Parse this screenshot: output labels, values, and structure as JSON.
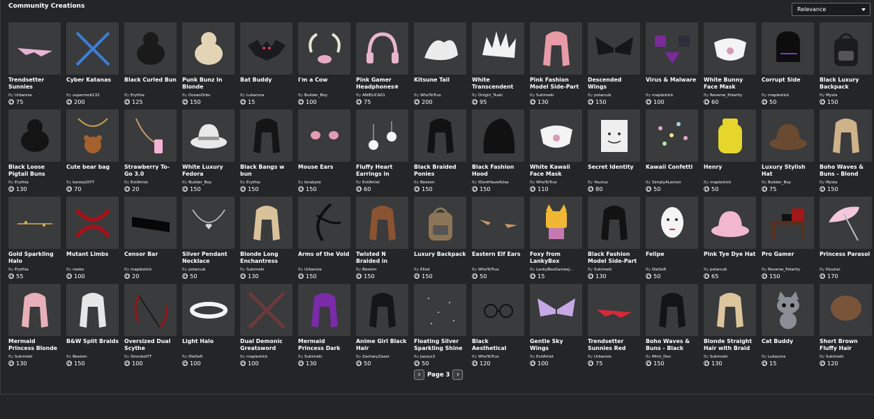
{
  "header": {
    "title": "Community Creations"
  },
  "sort": {
    "selected": "Relevance"
  },
  "by_prefix": "By",
  "items": [
    {
      "name": "Trendsetter Sunnies",
      "creator": "Urbanize",
      "price": "75",
      "icon": "sunglasses-icon",
      "color": "#e8b3d6"
    },
    {
      "name": "Cyber Katanas",
      "creator": "supermob132",
      "price": "200",
      "icon": "katana-icon",
      "color": "#3c7fd9"
    },
    {
      "name": "Black Curled Bun",
      "creator": "Erythia",
      "price": "125",
      "icon": "hair-bun-icon",
      "color": "#1a1a1a"
    },
    {
      "name": "Punk Bunz In Blonde",
      "creator": "OceanOrbs",
      "price": "150",
      "icon": "hair-bun-icon",
      "color": "#e4d4b6"
    },
    {
      "name": "Bat Buddy",
      "creator": "Lukacora",
      "price": "15",
      "icon": "bat-icon",
      "color": "#1b1b1f"
    },
    {
      "name": "I'm a Cow",
      "creator": "Builder_Boy",
      "price": "100",
      "icon": "horns-icon",
      "color": "#e9e3d2"
    },
    {
      "name": "Pink Gamer Headphones❀",
      "creator": "ANIELICA01",
      "price": "75",
      "icon": "headphones-icon",
      "color": "#e8b6cc"
    },
    {
      "name": "Kitsune Tail",
      "creator": "WhoToTrus",
      "price": "200",
      "icon": "tail-icon",
      "color": "#ececec"
    },
    {
      "name": "White Transcendent",
      "creator": "Onigiri_Tsuki",
      "price": "95",
      "icon": "spiky-hair-icon",
      "color": "#f2f2f2"
    },
    {
      "name": "Pink Fashion Model Side-Part",
      "creator": "Sukimeki",
      "price": "130",
      "icon": "long-hair-icon",
      "color": "#e89aa6"
    },
    {
      "name": "Descended Wings",
      "creator": "polarcub",
      "price": "150",
      "icon": "wings-icon",
      "color": "#161616"
    },
    {
      "name": "Virus & Malware",
      "creator": "maplestick",
      "price": "100",
      "icon": "virus-icon",
      "color": "#7a2a9a"
    },
    {
      "name": "White Bunny Face Mask",
      "creator": "Reverse_Polarity",
      "price": "60",
      "icon": "face-mask-icon",
      "color": "#f4f4f4"
    },
    {
      "name": "Corrupt Side",
      "creator": "maplestick",
      "price": "50",
      "icon": "helmet-icon",
      "color": "#0d0d0d"
    },
    {
      "name": "Black Luxury Backpack",
      "creator": "Mysta",
      "price": "150",
      "icon": "backpack-icon",
      "color": "#1c1c1e"
    },
    {
      "name": "Black Loose Pigtail Buns",
      "creator": "Erythia",
      "price": "130",
      "icon": "hair-bun-icon",
      "color": "#141414"
    },
    {
      "name": "Cute bear bag",
      "creator": "karola20YT",
      "price": "70",
      "icon": "bear-bag-icon",
      "color": "#a5612d"
    },
    {
      "name": "Strawberry To-Go 3.0",
      "creator": "EvilArtist",
      "price": "20",
      "icon": "drink-icon",
      "color": "#f2b3d4"
    },
    {
      "name": "White Luxury Fedora",
      "creator": "Builder_Boy",
      "price": "150",
      "icon": "hat-icon",
      "color": "#e8e8e8"
    },
    {
      "name": "Black Bangs w bun",
      "creator": "Erythia",
      "price": "150",
      "icon": "long-hair-icon",
      "color": "#151515"
    },
    {
      "name": "Mouse Ears",
      "creator": "terabyte",
      "price": "150",
      "icon": "ears-icon",
      "color": "#e49ab2"
    },
    {
      "name": "Fluffy Heart Earrings in White",
      "creator": "EvilArtist",
      "price": "60",
      "icon": "earrings-icon",
      "color": "#f5f5f5"
    },
    {
      "name": "Black Braided Ponies",
      "creator": "Beeism",
      "price": "150",
      "icon": "long-hair-icon",
      "color": "#121212"
    },
    {
      "name": "Black Fashion Hood",
      "creator": "IDontHaveAUse",
      "price": "150",
      "icon": "hood-icon",
      "color": "#111111"
    },
    {
      "name": "White Kawaii Face Mask",
      "creator": "WhoToTrus",
      "price": "110",
      "icon": "face-mask-icon",
      "color": "#f3f3f3"
    },
    {
      "name": "Secret Identity",
      "creator": "Yourius",
      "price": "80",
      "icon": "paper-bag-icon",
      "color": "#efefef"
    },
    {
      "name": "Kawaii Confetti",
      "creator": "SimplyALemon",
      "price": "50",
      "icon": "confetti-icon",
      "color": "#e3a6c8"
    },
    {
      "name": "Henry",
      "creator": "maplestick",
      "price": "50",
      "icon": "noob-head-icon",
      "color": "#e6d52a"
    },
    {
      "name": "Luxury Stylish Hat",
      "creator": "Builder_Boy",
      "price": "75",
      "icon": "bucket-hat-icon",
      "color": "#6a4a30"
    },
    {
      "name": "Boho Waves & Buns - Blond",
      "creator": "Mysta",
      "price": "150",
      "icon": "long-hair-icon",
      "color": "#cdb28a"
    },
    {
      "name": "Gold Sparkling Halo",
      "creator": "Erythia",
      "price": "55",
      "icon": "halo-icon",
      "color": "#d8b24a"
    },
    {
      "name": "Mutant Limbs",
      "creator": "nesko",
      "price": "100",
      "icon": "limbs-icon",
      "color": "#a0141a"
    },
    {
      "name": "Censor Bar",
      "creator": "maplestick",
      "price": "20",
      "icon": "censor-bar-icon",
      "color": "#060606"
    },
    {
      "name": "Silver Pendant Necklace",
      "creator": "polarcub",
      "price": "50",
      "icon": "necklace-icon",
      "color": "#d8d8d8"
    },
    {
      "name": "Blonde Long Enchantress Hair",
      "creator": "Sukimeki",
      "price": "130",
      "icon": "long-hair-icon",
      "color": "#d9c29a"
    },
    {
      "name": "Arms of the Void",
      "creator": "Urbanize",
      "price": "150",
      "icon": "tentacle-icon",
      "color": "#0e0e0e"
    },
    {
      "name": "Twisted N Braided in",
      "creator": "Beeism",
      "price": "150",
      "icon": "long-hair-icon",
      "color": "#8a5432"
    },
    {
      "name": "Luxury Backpack",
      "creator": "Ellod",
      "price": "150",
      "icon": "backpack-icon",
      "color": "#8c7556"
    },
    {
      "name": "Eastern Elf Ears",
      "creator": "WhoToTrus",
      "price": "50",
      "icon": "elf-ears-icon",
      "color": "#c9956a"
    },
    {
      "name": "Foxy from LankyBox",
      "creator": "LankyBoxGamesJ...",
      "price": "15",
      "icon": "fox-icon",
      "color": "#f0b832"
    },
    {
      "name": "Black Fashion Model Side-Part",
      "creator": "Sukimeki",
      "price": "130",
      "icon": "long-hair-icon",
      "color": "#121212"
    },
    {
      "name": "Felipe",
      "creator": "DieSoft",
      "price": "50",
      "icon": "mask-head-icon",
      "color": "#f4f4f4"
    },
    {
      "name": "Pink Tye Dye Hat",
      "creator": "polarcub",
      "price": "65",
      "icon": "bucket-hat-icon",
      "color": "#f2b7cf"
    },
    {
      "name": "Pro Gamer",
      "creator": "Reverse_Polarity",
      "price": "150",
      "icon": "desk-icon",
      "color": "#5a2e1e"
    },
    {
      "name": "Princess Parasol",
      "creator": "Kiouhei",
      "price": "170",
      "icon": "parasol-icon",
      "color": "#f3c8dc"
    },
    {
      "name": "Mermaid Princess Blonde to Pink",
      "creator": "Sukimeki",
      "price": "130",
      "icon": "long-hair-icon",
      "color": "#e7b0b8"
    },
    {
      "name": "B&W Split Braids",
      "creator": "Beeism",
      "price": "150",
      "icon": "long-hair-icon",
      "color": "#e6e6e6"
    },
    {
      "name": "Oversized Dual Scythe",
      "creator": "StronbolYT",
      "price": "100",
      "icon": "scythe-icon",
      "color": "#8e1717"
    },
    {
      "name": "Light Halo",
      "creator": "DieSoft",
      "price": "100",
      "icon": "ring-halo-icon",
      "color": "#f4f4f4"
    },
    {
      "name": "Dual Demonic Greatsword",
      "creator": "maplestick",
      "price": "100",
      "icon": "swords-icon",
      "color": "#6b3a3a"
    },
    {
      "name": "Mermaid Princess Dark Purple Hair",
      "creator": "Sukimeki",
      "price": "130",
      "icon": "long-hair-icon",
      "color": "#7a2ba8"
    },
    {
      "name": "Anime Girl Black Hair",
      "creator": "ZacharyZaxor",
      "price": "50",
      "icon": "long-hair-icon",
      "color": "#161616"
    },
    {
      "name": "Floating Silver Sparkling Shine",
      "creator": "Jazzyx3",
      "price": "50",
      "icon": "sparkles-icon",
      "color": "#d6d6d6"
    },
    {
      "name": "Black Aesthetical Glasses",
      "creator": "WhoToTrus",
      "price": "120",
      "icon": "glasses-icon",
      "color": "#111111"
    },
    {
      "name": "Gentle Sky Wings",
      "creator": "EvilArtist",
      "price": "100",
      "icon": "wings-icon",
      "color": "#c6a8e6"
    },
    {
      "name": "Trendsetter Sunnies Red",
      "creator": "Urbanize",
      "price": "75",
      "icon": "sunglasses-icon",
      "color": "#d8283a"
    },
    {
      "name": "Boho Waves & Buns - Black",
      "creator": "Mimi_Dev",
      "price": "150",
      "icon": "long-hair-icon",
      "color": "#141414"
    },
    {
      "name": "Blonde Straight Hair with Braid",
      "creator": "Sukimeki",
      "price": "130",
      "icon": "long-hair-icon",
      "color": "#dcc49c"
    },
    {
      "name": "Cat Buddy",
      "creator": "Lukacora",
      "price": "15",
      "icon": "cat-icon",
      "color": "#8a8f96"
    },
    {
      "name": "Short Brown Fluffy Hair",
      "creator": "Sukimeki",
      "price": "120",
      "icon": "short-hair-icon",
      "color": "#7a5438"
    }
  ],
  "pagination": {
    "prev": "‹",
    "label": "Page 3",
    "next": "›"
  }
}
